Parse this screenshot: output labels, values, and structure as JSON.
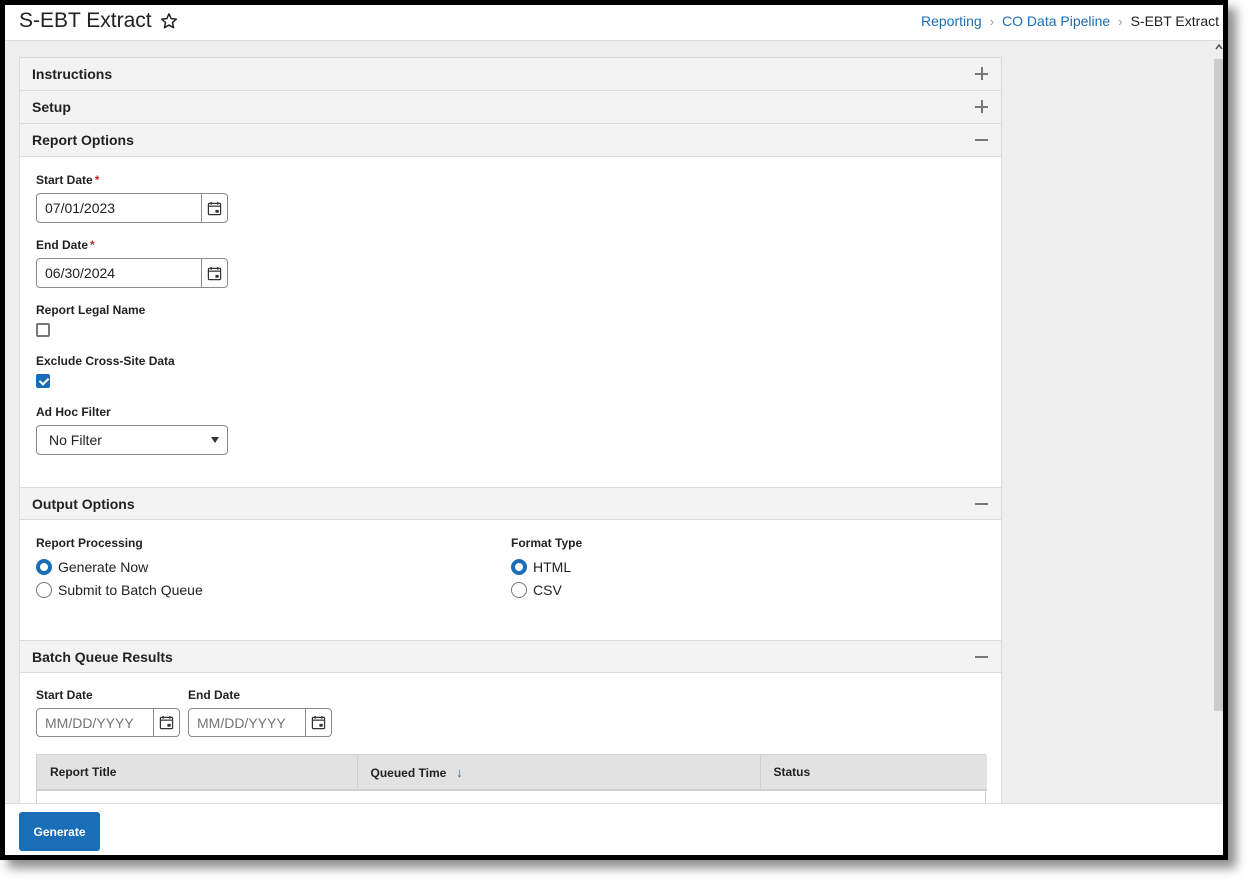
{
  "header": {
    "title": "S-EBT Extract",
    "favorite_icon": "star-outline-icon",
    "breadcrumb": [
      {
        "label": "Reporting",
        "link": true
      },
      {
        "label": "CO Data Pipeline",
        "link": true
      },
      {
        "label": "S-EBT Extract",
        "link": false
      }
    ]
  },
  "sections": {
    "instructions": {
      "title": "Instructions",
      "state": "collapsed"
    },
    "setup": {
      "title": "Setup",
      "state": "collapsed"
    },
    "report_options": {
      "title": "Report Options",
      "state": "expanded",
      "start_date": {
        "label": "Start Date",
        "required": "*",
        "value": "07/01/2023"
      },
      "end_date": {
        "label": "End Date",
        "required": "*",
        "value": "06/30/2024"
      },
      "report_legal_name": {
        "label": "Report Legal Name",
        "checked": false
      },
      "exclude_cross_site": {
        "label": "Exclude Cross-Site Data",
        "checked": true
      },
      "ad_hoc_filter": {
        "label": "Ad Hoc Filter",
        "selected": "No Filter"
      }
    },
    "output_options": {
      "title": "Output Options",
      "state": "expanded",
      "report_processing": {
        "label": "Report Processing",
        "options": [
          {
            "label": "Generate Now",
            "selected": true
          },
          {
            "label": "Submit to Batch Queue",
            "selected": false
          }
        ]
      },
      "format_type": {
        "label": "Format Type",
        "options": [
          {
            "label": "HTML",
            "selected": true
          },
          {
            "label": "CSV",
            "selected": false
          }
        ]
      }
    },
    "batch_queue": {
      "title": "Batch Queue Results",
      "state": "expanded",
      "start_date": {
        "label": "Start Date",
        "placeholder": "MM/DD/YYYY"
      },
      "end_date": {
        "label": "End Date",
        "placeholder": "MM/DD/YYYY"
      },
      "columns": [
        "Report Title",
        "Queued Time",
        "Status"
      ],
      "sort_icon": "arrow-down-icon",
      "rows": []
    }
  },
  "footer": {
    "generate_label": "Generate"
  },
  "colors": {
    "accent": "#1a6eb8",
    "required": "#c0262d",
    "section_bg": "#f3f3f3",
    "page_bg": "#efefef"
  }
}
